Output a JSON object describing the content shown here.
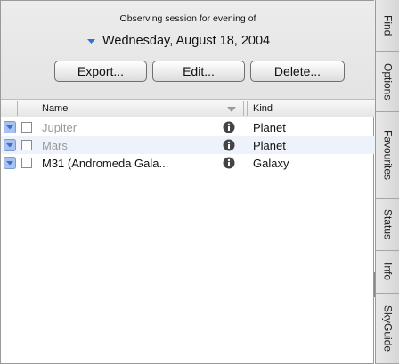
{
  "header": {
    "session_title": "Observing session for evening of",
    "date": "Wednesday, August 18, 2004"
  },
  "buttons": {
    "export": "Export...",
    "edit": "Edit...",
    "delete": "Delete..."
  },
  "columns": {
    "name": "Name",
    "kind": "Kind"
  },
  "rows": [
    {
      "name": "Jupiter",
      "kind": "Planet",
      "checked": true,
      "dimmed": true
    },
    {
      "name": "Mars",
      "kind": "Planet",
      "checked": true,
      "dimmed": true
    },
    {
      "name": "M31 (Andromeda Gala...",
      "kind": "Galaxy",
      "checked": true,
      "dimmed": false
    }
  ],
  "side_tabs": [
    "Find",
    "Options",
    "Favourites",
    "Status",
    "Info",
    "SkyGuide"
  ],
  "colors": {
    "accent": "#3a6fd0",
    "row_alt": "#eef2fb"
  }
}
